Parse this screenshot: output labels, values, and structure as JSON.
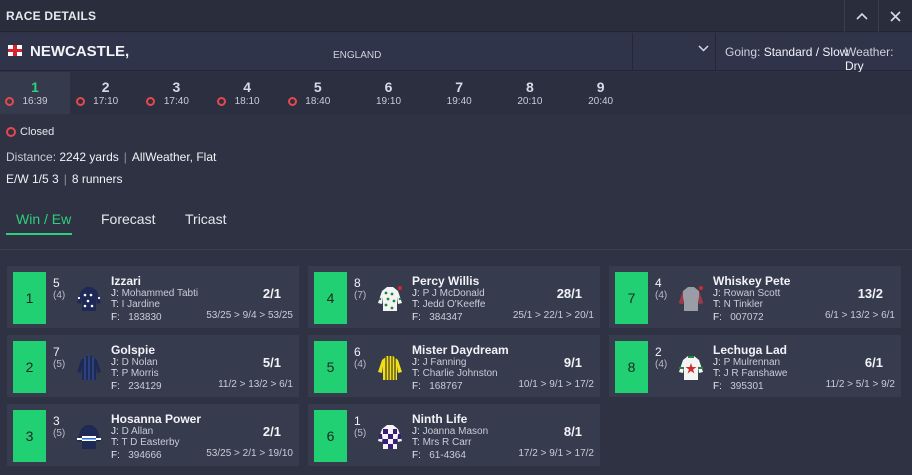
{
  "window": {
    "title": "RACE DETAILS"
  },
  "venue": {
    "name": "NEWCASTLE,",
    "country": "ENGLAND",
    "going_label": "Going:",
    "going": "Standard / Slow",
    "weather_label": "Weather:",
    "weather": "Dry"
  },
  "races": [
    {
      "num": "1",
      "time": "16:39",
      "active": true,
      "closed": true
    },
    {
      "num": "2",
      "time": "17:10",
      "closed": true
    },
    {
      "num": "3",
      "time": "17:40",
      "closed": true
    },
    {
      "num": "4",
      "time": "18:10",
      "closed": true
    },
    {
      "num": "5",
      "time": "18:40",
      "closed": true
    },
    {
      "num": "6",
      "time": "19:10",
      "closed": false
    },
    {
      "num": "7",
      "time": "19:40",
      "closed": false
    },
    {
      "num": "8",
      "time": "20:10",
      "closed": false
    },
    {
      "num": "9",
      "time": "20:40",
      "closed": false
    }
  ],
  "race_info": {
    "status": "Closed",
    "distance_label": "Distance:",
    "distance": "2242 yards",
    "surface": "AllWeather, Flat",
    "ew": "E/W 1/5 3",
    "runners": "8 runners"
  },
  "bet_tabs": [
    "Win / Ew",
    "Forecast",
    "Tricast"
  ],
  "runners": [
    {
      "cloth": "1",
      "stall": "5",
      "draw": "(4)",
      "name": "Izzari",
      "jockey": "Mohammed Tabti",
      "trainer": "I Jardine",
      "form": "183830",
      "odds": "2/1",
      "prev": "53/25 > 9/4 > 53/25",
      "silk": "navy-dots"
    },
    {
      "cloth": "2",
      "stall": "7",
      "draw": "(5)",
      "name": "Golspie",
      "jockey": "D Nolan",
      "trainer": "P Morris",
      "form": "234129",
      "odds": "5/1",
      "prev": "11/2 > 13/2 > 6/1",
      "silk": "navy-stripes"
    },
    {
      "cloth": "3",
      "stall": "3",
      "draw": "(5)",
      "name": "Hosanna Power",
      "jockey": "D Allan",
      "trainer": "T D Easterby",
      "form": "394666",
      "odds": "2/1",
      "prev": "53/25 > 2/1 > 19/10",
      "silk": "navy-hoop"
    },
    {
      "cloth": "4",
      "stall": "8",
      "draw": "(7)",
      "name": "Percy Willis",
      "jockey": "P J McDonald",
      "trainer": "Jedd O'Keeffe",
      "form": "384347",
      "odds": "28/1",
      "prev": "25/1 > 22/1 > 20/1",
      "silk": "white-green-spots"
    },
    {
      "cloth": "5",
      "stall": "6",
      "draw": "(4)",
      "name": "Mister Daydream",
      "jockey": "J Fanning",
      "trainer": "Charlie Johnston",
      "form": "168767",
      "odds": "9/1",
      "prev": "10/1 > 9/1 > 17/2",
      "silk": "yellow-stripes"
    },
    {
      "cloth": "6",
      "stall": "1",
      "draw": "(5)",
      "name": "Ninth Life",
      "jockey": "Joanna Mason",
      "trainer": "Mrs R Carr",
      "form": "61-4364",
      "odds": "8/1",
      "prev": "17/2 > 9/1 > 17/2",
      "silk": "purple-check"
    },
    {
      "cloth": "7",
      "stall": "4",
      "draw": "(4)",
      "name": "Whiskey Pete",
      "jockey": "Rowan Scott",
      "trainer": "N Tinkler",
      "form": "007072",
      "odds": "13/2",
      "prev": "6/1 > 13/2 > 6/1",
      "silk": "grey-red-cap"
    },
    {
      "cloth": "8",
      "stall": "2",
      "draw": "(4)",
      "name": "Lechuga Lad",
      "jockey": "P Mulrennan",
      "trainer": "J R Fanshawe",
      "form": "395301",
      "odds": "6/1",
      "prev": "11/2 > 5/1 > 9/2",
      "silk": "white-red-star"
    }
  ],
  "labels": {
    "jockey": "J:",
    "trainer": "T:",
    "form": "F:"
  },
  "colors": {
    "accent": "#2fd07a",
    "cloth": "#20d073",
    "closed": "#e5484d"
  }
}
